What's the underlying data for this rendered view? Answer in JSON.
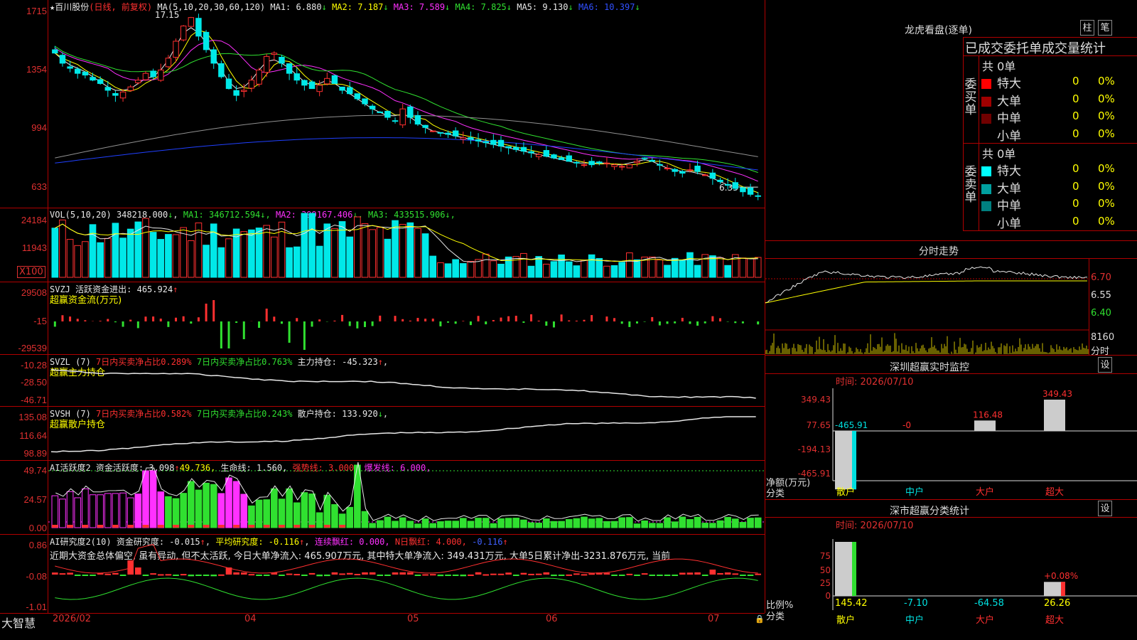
{
  "stock": {
    "name": "百川股份",
    "mode": "(日线, 前复权)"
  },
  "price_panel": {
    "ma_label": "MA(5,10,20,30,60,120)",
    "ma": [
      {
        "label": "MA1:",
        "value": "6.880",
        "color": "#e8e8e8"
      },
      {
        "label": "MA2:",
        "value": "7.187",
        "color": "#ffff00"
      },
      {
        "label": "MA3:",
        "value": "7.589",
        "color": "#ff30ff"
      },
      {
        "label": "MA4:",
        "value": "7.825",
        "color": "#30e030"
      },
      {
        "label": "MA5:",
        "value": "9.130",
        "color": "#e8e8e8"
      },
      {
        "label": "MA6:",
        "value": "10.397",
        "color": "#3050ff"
      }
    ],
    "axis": [
      "1715",
      "1354",
      "994",
      "633"
    ],
    "high_label": "17.15",
    "low_label": "6.33",
    "chart_data": {
      "type": "candlestick",
      "ylim": [
        6.0,
        17.6
      ],
      "close": [
        14.8,
        14.2,
        13.9,
        13.6,
        13.5,
        13.2,
        13.0,
        12.6,
        12.3,
        12.5,
        12.8,
        13.2,
        13.6,
        13.4,
        13.8,
        14.5,
        15.5,
        16.4,
        16.9,
        15.8,
        15.0,
        14.2,
        13.4,
        12.7,
        12.3,
        12.6,
        13.2,
        13.8,
        14.6,
        14.8,
        14.2,
        13.6,
        13.2,
        12.9,
        12.7,
        12.9,
        13.3,
        13.0,
        12.6,
        12.4,
        12.1,
        11.8,
        11.5,
        11.3,
        11.0,
        10.8,
        11.5,
        11.0,
        10.6,
        10.4,
        10.2,
        10.1,
        10.0,
        9.9,
        9.8,
        9.7,
        9.6,
        9.5,
        9.4,
        9.3,
        9.2,
        9.1,
        9.0,
        8.9,
        8.8,
        8.7,
        8.6,
        8.5,
        8.4,
        8.3,
        8.2,
        8.2,
        8.3,
        8.3,
        8.2,
        8.1,
        8.2,
        8.4,
        8.6,
        8.4,
        8.2,
        8.0,
        7.8,
        7.7,
        7.9,
        7.8,
        7.6,
        7.4,
        7.2,
        7.0,
        6.8,
        6.6,
        6.45,
        6.33
      ],
      "ma": {
        "MA1": [
          14.8,
          14.4,
          14.1,
          13.9,
          13.7,
          13.4,
          13.1,
          12.8,
          12.6,
          12.6,
          12.7,
          13.0,
          13.3,
          13.4,
          13.8,
          14.4,
          15.2,
          16.0,
          16.3,
          16.0,
          15.4,
          14.6,
          13.8,
          13.1,
          12.7,
          12.8,
          13.2,
          13.8,
          14.3,
          14.4,
          14.2,
          13.9,
          13.5,
          13.1,
          12.9,
          13.0,
          13.2,
          13.0,
          12.7,
          12.4,
          12.1,
          11.8,
          11.5,
          11.3,
          11.1,
          11.1,
          11.2,
          11.0,
          10.7,
          10.4,
          10.2,
          10.1,
          10.0,
          9.9,
          9.8,
          9.7,
          9.6,
          9.5,
          9.4,
          9.3,
          9.2,
          9.1,
          9.0,
          8.9,
          8.8,
          8.7,
          8.6,
          8.5,
          8.4,
          8.3,
          8.3,
          8.3,
          8.3,
          8.3,
          8.2,
          8.2,
          8.3,
          8.4,
          8.5,
          8.4,
          8.2,
          8.0,
          7.9,
          7.8,
          7.8,
          7.7,
          7.6,
          7.4,
          7.2,
          7.0,
          6.9,
          6.88,
          6.88,
          6.88
        ]
      }
    }
  },
  "vol_panel": {
    "header": "VOL(5,10,20)",
    "value": "348218.000",
    "ma": [
      {
        "label": "MA1:",
        "value": "346712.594",
        "color": "#30e030"
      },
      {
        "label": "MA2:",
        "value": "399167.406",
        "color": "#ff30ff"
      },
      {
        "label": "MA3:",
        "value": "433515.906",
        "color": "#30e030"
      }
    ],
    "axis": [
      "24184",
      "11943"
    ],
    "unit": "X100"
  },
  "svzj_panel": {
    "header": "SVZJ",
    "label": "活跃资金进出:",
    "value": "465.924",
    "sub": "超赢资金流(万元)",
    "axis": [
      "29508",
      "-15",
      "-29539"
    ]
  },
  "svzl_panel": {
    "header": "SVZL (7)",
    "part1": "7日内买卖净占比0.289%",
    "part2": "7日内买卖净占比0.763%",
    "part3": "主力持仓: -45.323",
    "sub": "超赢主力持仓",
    "axis": [
      "-10.28",
      "-28.50",
      "-46.71"
    ]
  },
  "svsh_panel": {
    "header": "SVSH (7)",
    "part1": "7日内买卖净占比0.582%",
    "part2": "7日内买卖净占比0.243%",
    "part3": "散户持仓: 133.920",
    "sub": "超赢散户持仓",
    "axis": [
      "135.08",
      "116.64",
      "98.89"
    ]
  },
  "ai_active_panel": {
    "header": "AI活跃度2",
    "p1": "资金活跃度: 3.098",
    "p2": "49.736,",
    "p3": "生命线: 1.560,",
    "p4": "强势线: 3.000,",
    "p5": "爆发线: 6.000,",
    "axis": [
      "49.74",
      "24.57",
      "0.00"
    ]
  },
  "ai_research_panel": {
    "header": "AI研究度2(10)",
    "p1": "资金研究度: -0.015",
    "p2": "平均研究度: -0.116",
    "p3": "连续飘红: 0.000,",
    "p4": "N日飘红: 4.000,",
    "p5": "-0.116",
    "commentary": "近期大资金总体偏空, 虽有异动, 但不太活跃, 今日大单净流入: 465.907万元, 其中特大单净流入: 349.431万元, 大单5日累计净出-3231.876万元, 当前",
    "axis": [
      "0.86",
      "-0.08",
      "-1.01"
    ]
  },
  "bottom": {
    "brand": "大智慧",
    "dates": [
      "2026/02",
      "04",
      "05",
      "06",
      "07"
    ]
  },
  "lhkp": {
    "title": "龙虎看盘(逐单)",
    "btn1": "柱",
    "btn2": "笔",
    "subtitle": "已成交委托单成交量统计",
    "buy": {
      "label": "委买单",
      "total": "共 0单",
      "rows": [
        {
          "name": "特大",
          "count": "0",
          "pct": "0%",
          "color": "#ff0000"
        },
        {
          "name": "大单",
          "count": "0",
          "pct": "0%",
          "color": "#a00000"
        },
        {
          "name": "中单",
          "count": "0",
          "pct": "0%",
          "color": "#700000"
        },
        {
          "name": "小单",
          "count": "0",
          "pct": "0%",
          "color": ""
        }
      ]
    },
    "sell": {
      "label": "委卖单",
      "total": "共 0单",
      "rows": [
        {
          "name": "特大",
          "count": "0",
          "pct": "0%",
          "color": "#00ffff"
        },
        {
          "name": "大单",
          "count": "0",
          "pct": "0%",
          "color": "#00a0a0"
        },
        {
          "name": "中单",
          "count": "0",
          "pct": "0%",
          "color": "#008080"
        },
        {
          "name": "小单",
          "count": "0",
          "pct": "0%",
          "color": ""
        }
      ]
    }
  },
  "intraday": {
    "title": "分时走势",
    "axis": [
      "6.70",
      "6.55",
      "6.40"
    ],
    "vol_axis": "8160",
    "vol_unit": "分时"
  },
  "sz_monitor": {
    "title": "深圳超赢实时监控",
    "set": "设",
    "time": "时间: 2026/07/10",
    "axis": [
      "349.43",
      "77.65",
      "-194.13",
      "-465.91"
    ],
    "bars": [
      {
        "cat": "散户",
        "value": -465.91,
        "label": "-465.91"
      },
      {
        "cat": "中户",
        "value": -0.0,
        "label": "-0"
      },
      {
        "cat": "大户",
        "value": 116.48,
        "label": "116.48"
      },
      {
        "cat": "超大",
        "value": 349.43,
        "label": "349.43"
      }
    ],
    "ylabel": "净额(万元)",
    "xlabel": "分类"
  },
  "sz_class": {
    "title": "深市超赢分类统计",
    "set": "设",
    "time": "时间: 2026/07/10",
    "axis": [
      "75",
      "50",
      "25",
      "0"
    ],
    "bars": [
      {
        "cat": "散户",
        "value": 145.42,
        "label": "145.42"
      },
      {
        "cat": "中户",
        "value": -7.1,
        "label": "-7.10"
      },
      {
        "cat": "大户",
        "value": -64.58,
        "label": "-64.58"
      },
      {
        "cat": "超大",
        "value": 26.26,
        "label": "26.26"
      }
    ],
    "extra": "+0.08%",
    "ylabel": "比例%",
    "xlabel": "分类"
  }
}
